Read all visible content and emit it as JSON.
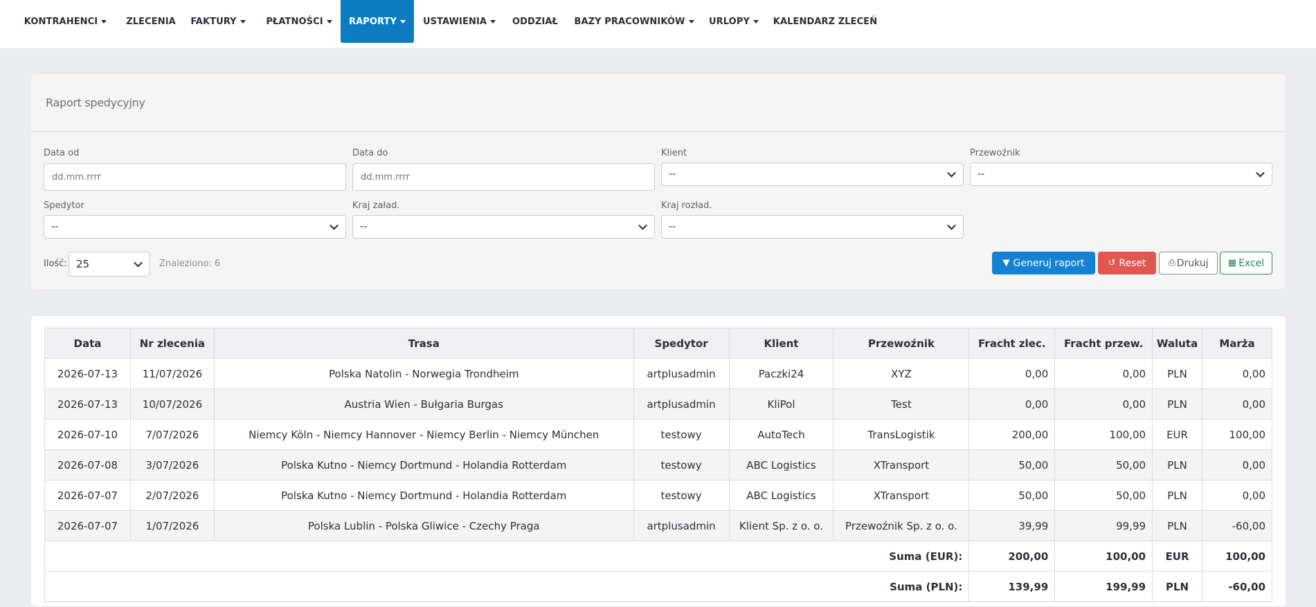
{
  "nav": {
    "items": [
      {
        "label": "KONTRAHENCI",
        "dropdown": true
      },
      {
        "label": "ZLECENIA",
        "dropdown": false
      },
      {
        "label": "FAKTURY",
        "dropdown": true
      },
      {
        "label": "PŁATNOŚCI",
        "dropdown": true
      },
      {
        "label": "RAPORTY",
        "dropdown": true,
        "active": true
      },
      {
        "label": "USTAWIENIA",
        "dropdown": true
      },
      {
        "label": "ODDZIAŁ",
        "dropdown": false
      },
      {
        "label": "BAZY PRACOWNIKÓW",
        "dropdown": true
      },
      {
        "label": "URLOPY",
        "dropdown": true
      },
      {
        "label": "KALENDARZ ZLECEŃ",
        "dropdown": false
      }
    ],
    "active_color": "#0b7cc1"
  },
  "filters": {
    "title": "Raport spedycyjny",
    "date_from": {
      "label": "Data od",
      "placeholder": "dd.mm.rrrr"
    },
    "date_to": {
      "label": "Data do",
      "placeholder": "dd.mm.rrrr"
    },
    "client": {
      "label": "Klient",
      "value": "--"
    },
    "carrier": {
      "label": "Przewoźnik",
      "value": "--"
    },
    "forwarder": {
      "label": "Spedytor",
      "value": "--"
    },
    "loading_country": {
      "label": "Kraj załad.",
      "value": "--"
    },
    "unloading_country": {
      "label": "Kraj rozład.",
      "value": "--"
    },
    "count_label": "Ilość:",
    "count_value": "25",
    "found_text": "Znaleziono: 6",
    "buttons": {
      "generate": "Generuj raport",
      "reset": "Reset",
      "print": "Drukuj",
      "excel": "Excel"
    },
    "button_colors": {
      "generate": "#1482d0",
      "reset": "#e05851",
      "excel": "#1f8a4d"
    }
  },
  "table": {
    "headers": [
      "Data",
      "Nr zlecenia",
      "Trasa",
      "Spedytor",
      "Klient",
      "Przewoźnik",
      "Fracht zlec.",
      "Fracht przew.",
      "Waluta",
      "Marża"
    ],
    "rows": [
      [
        "2026-07-13",
        "11/07/2026",
        "Polska Natolin - Norwegia Trondheim",
        "artplusadmin",
        "Paczki24",
        "XYZ",
        "0,00",
        "0,00",
        "PLN",
        "0,00"
      ],
      [
        "2026-07-13",
        "10/07/2026",
        "Austria Wien - Bułgaria Burgas",
        "artplusadmin",
        "KliPol",
        "Test",
        "0,00",
        "0,00",
        "PLN",
        "0,00"
      ],
      [
        "2026-07-10",
        "7/07/2026",
        "Niemcy Köln - Niemcy Hannover - Niemcy Berlin - Niemcy München",
        "testowy",
        "AutoTech",
        "TransLogistik",
        "200,00",
        "100,00",
        "EUR",
        "100,00"
      ],
      [
        "2026-07-08",
        "3/07/2026",
        "Polska Kutno - Niemcy Dortmund - Holandia Rotterdam",
        "testowy",
        "ABC Logistics",
        "XTransport",
        "50,00",
        "50,00",
        "PLN",
        "0,00"
      ],
      [
        "2026-07-07",
        "2/07/2026",
        "Polska Kutno - Niemcy Dortmund - Holandia Rotterdam",
        "testowy",
        "ABC Logistics",
        "XTransport",
        "50,00",
        "50,00",
        "PLN",
        "0,00"
      ],
      [
        "2026-07-07",
        "1/07/2026",
        "Polska Lublin - Polska Gliwice - Czechy Praga",
        "artplusadmin",
        "Klient Sp. z o. o.",
        "Przewoźnik Sp. z o. o.",
        "39,99",
        "99,99",
        "PLN",
        "-60,00"
      ]
    ],
    "sums": [
      {
        "label": "Suma (EUR):",
        "fracht_zlec": "200,00",
        "fracht_przew": "100,00",
        "currency": "EUR",
        "margin": "100,00"
      },
      {
        "label": "Suma (PLN):",
        "fracht_zlec": "139,99",
        "fracht_przew": "199,99",
        "currency": "PLN",
        "margin": "-60,00"
      }
    ]
  }
}
